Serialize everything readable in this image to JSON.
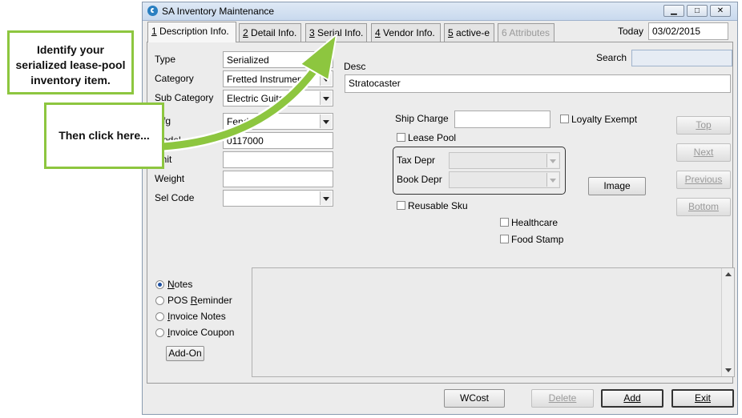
{
  "window": {
    "title": "SA Inventory Maintenance",
    "min": "▁",
    "max": "□",
    "close": "✕"
  },
  "tabs": [
    {
      "num": "1",
      "label": " Description Info."
    },
    {
      "num": "2",
      "label": " Detail Info."
    },
    {
      "num": "3",
      "label": " Serial Info."
    },
    {
      "num": "4",
      "label": " Vendor Info."
    },
    {
      "num": "5",
      "label": " active-e"
    },
    {
      "num": "6",
      "label": " Attributes"
    }
  ],
  "today": {
    "label": "Today",
    "value": "03/02/2015"
  },
  "search": {
    "label": "Search",
    "value": ""
  },
  "desc": {
    "label": "Desc",
    "value": "Stratocaster"
  },
  "form": {
    "type_label": "Type",
    "type_value": "Serialized",
    "category_label": "Category",
    "category_value": "Fretted Instruments",
    "subcategory_label": "Sub Category",
    "subcategory_value": "Electric Guitars",
    "mfg_label": "Mfg",
    "mfg_value": "Fender",
    "model_label": "Model",
    "model_value": "0117000",
    "unit_label": "Unit",
    "unit_value": "",
    "weight_label": "Weight",
    "weight_value": "",
    "selcode_label": "Sel Code",
    "selcode_value": ""
  },
  "ship_charge": {
    "label": "Ship Charge",
    "value": ""
  },
  "loyalty_exempt": "Loyalty Exempt",
  "lease_pool": "Lease Pool",
  "tax_depr": "Tax Depr",
  "book_depr": "Book Depr",
  "reusable_sku": "Reusable Sku",
  "healthcare": "Healthcare",
  "food_stamp": "Food Stamp",
  "image_button": "Image",
  "nav": {
    "top": "Top",
    "next": "Next",
    "previous": "Previous",
    "bottom": "Bottom"
  },
  "notes_options": [
    {
      "pre": "",
      "ul": "N",
      "post": "otes"
    },
    {
      "pre": "POS ",
      "ul": "R",
      "post": "eminder"
    },
    {
      "pre": "",
      "ul": "I",
      "post": "nvoice Notes"
    },
    {
      "pre": "",
      "ul": "I",
      "post": "nvoice Coupon"
    }
  ],
  "addon_button": "Add-On",
  "bottom_buttons": {
    "wcost": "WCost",
    "delete": "Delete",
    "add": "Add",
    "exit": "Exit"
  },
  "callouts": {
    "first": "Identify your serialized lease-pool inventory item.",
    "second": "Then click here..."
  },
  "colors": {
    "accent": "#8dc63f",
    "title_bar": "#c9d9ee"
  }
}
